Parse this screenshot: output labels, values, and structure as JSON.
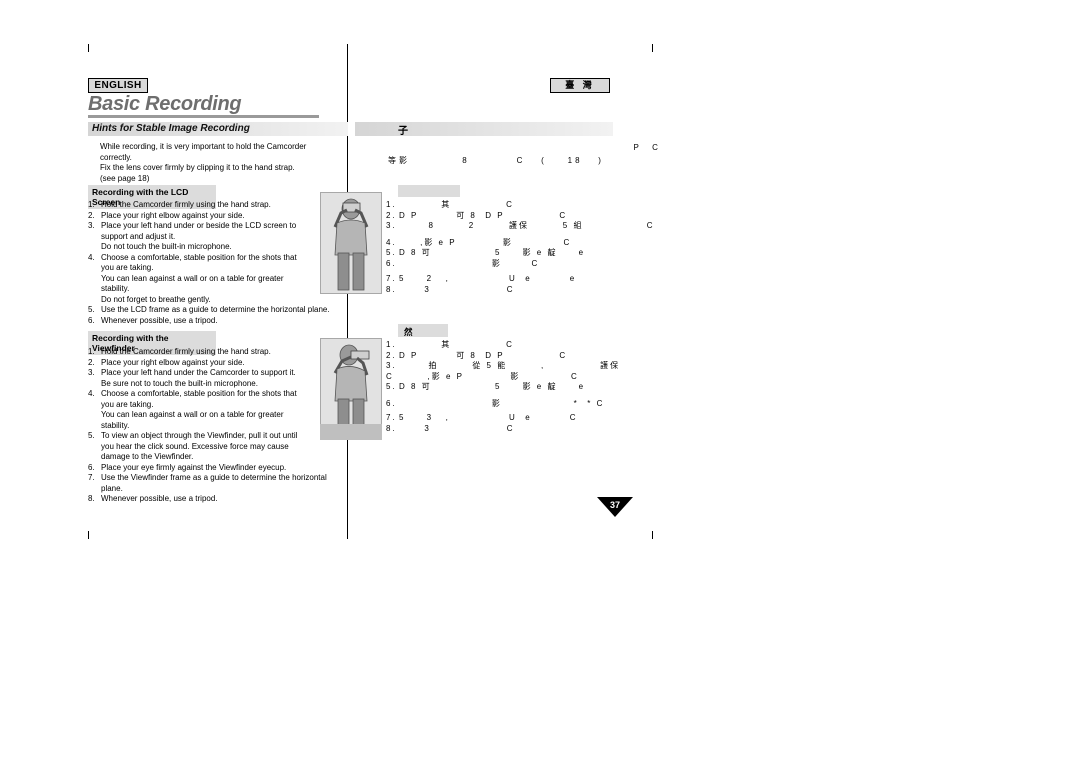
{
  "header": {
    "language_badge": "ENGLISH",
    "chapter_title": "Basic Recording",
    "section_title": "Hints for Stable Image Recording"
  },
  "intro": {
    "text": "While recording, it is very important to hold the Camcorder\ncorrectly.\nFix the lens cover firmly by clipping it to the hand strap.\n(see page 18)"
  },
  "lcd_section": {
    "heading": "Recording with the LCD Screen",
    "items": [
      {
        "num": "1.",
        "text": "Hold the Camcorder firmly using the hand strap."
      },
      {
        "num": "2.",
        "text": "Place your right elbow against your side."
      },
      {
        "num": "3.",
        "text": "Place your left hand under or beside the LCD screen to\nsupport and adjust it.\nDo not touch the built-in microphone."
      },
      {
        "num": "4.",
        "text": "Choose a comfortable, stable position for the shots that\nyou are taking.\nYou can lean against a wall or on a table for greater\nstability.\nDo not forget to breathe gently."
      },
      {
        "num": "5.",
        "text": "Use the LCD frame as a guide to determine the horizontal plane."
      },
      {
        "num": "6.",
        "text": "Whenever possible, use a tripod."
      }
    ]
  },
  "viewfinder_section": {
    "heading": "Recording with the Viewfinder",
    "items": [
      {
        "num": "1.",
        "text": "Hold the Camcorder firmly using the hand strap."
      },
      {
        "num": "2.",
        "text": "Place your right elbow against your side."
      },
      {
        "num": "3.",
        "text": "Place your left hand under the Camcorder to support it.\nBe sure not to touch the built-in microphone."
      },
      {
        "num": "4.",
        "text": "Choose a comfortable, stable position for the shots that\nyou are taking.\nYou can lean against a wall or on a table for greater\nstability."
      },
      {
        "num": "5.",
        "text": "To view an object through the Viewfinder, pull it out until\nyou hear the click sound. Excessive force may cause\ndamage to the Viewfinder."
      },
      {
        "num": "6.",
        "text": "Place your eye firmly against the Viewfinder eyecup."
      },
      {
        "num": "7.",
        "text": "Use the Viewfinder frame as a guide to determine the horizontal\nplane."
      },
      {
        "num": "8.",
        "text": "Whenever possible, use a tripod."
      }
    ]
  },
  "chinese": {
    "region_badge": "臺 灣",
    "section_title": "子",
    "intro_lines": [
      "                                               P  C",
      "等影          8         C   (    18   )"
    ],
    "lcd": {
      "heading": "",
      "items": [
        {
          "num": "1.",
          "text": "          其             C"
        },
        {
          "num": "2.",
          "text": "D P         可 8  D P             C"
        },
        {
          "num": "3.",
          "text": "       8        2        護保        5 組               C"
        },
        {
          "num": "4.",
          "text": "     ,影 e P           影            C"
        },
        {
          "num": "5.",
          "text": "D 8 可               5     影 e 靛     e"
        },
        {
          "num": "6.",
          "text": "                      影       C"
        },
        {
          "num": "7.",
          "text": "5     2   ,              U  e         e"
        },
        {
          "num": "8.",
          "text": "      3                  C"
        }
      ]
    },
    "viewfinder": {
      "heading": "然",
      "items": [
        {
          "num": "1.",
          "text": "          其             C"
        },
        {
          "num": "2.",
          "text": "D P         可 8  D P             C"
        },
        {
          "num": "3.",
          "text": "       拍        從 5 能        ,             護保"
        },
        {
          "num": "4.",
          "text": "C        ,影 e P           影            C"
        },
        {
          "num": "5.",
          "text": "D 8 可               5     影 e 靛     e"
        },
        {
          "num": "6.",
          "text": "                      影                 *  * C"
        },
        {
          "num": "7.",
          "text": "5     3   ,              U  e         C"
        },
        {
          "num": "8.",
          "text": "      3                  C"
        }
      ]
    }
  },
  "page_number": "37",
  "figures": {
    "lcd_figure_alt": "person-holding-camcorder-lcd",
    "viewfinder_figure_alt": "person-holding-camcorder-viewfinder"
  }
}
